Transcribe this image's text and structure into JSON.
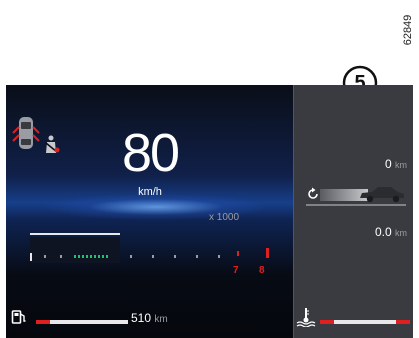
{
  "figure": {
    "reference_code": "62849",
    "callout_number": "5"
  },
  "speedometer": {
    "value": "80",
    "unit": "km/h"
  },
  "tachometer": {
    "scale_label": "x 1000",
    "redline_labels": [
      "7",
      "8"
    ]
  },
  "fuel": {
    "range_value": "510",
    "range_unit": "km"
  },
  "trip": {
    "distance_value": "0",
    "distance_unit": "km",
    "economy_value": "0.0",
    "economy_unit": "km"
  },
  "icons": [
    "car-doors-open-icon",
    "seatbelt-warning-icon",
    "fuel-pump-icon",
    "reset-arrow-icon",
    "car-silhouette-icon",
    "coolant-temperature-icon"
  ],
  "colors": {
    "warning_red": "#e02020",
    "display_blue": "#173f8a",
    "green_segment": "#19c46b"
  }
}
